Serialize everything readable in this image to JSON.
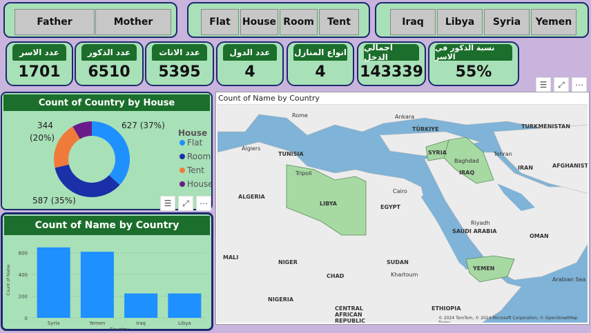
{
  "slicers": {
    "relation": [
      "Father",
      "Mother"
    ],
    "house": [
      "Flat",
      "House",
      "Room",
      "Tent"
    ],
    "country": [
      "Iraq",
      "Libya",
      "Syria",
      "Yemen"
    ]
  },
  "cards": [
    {
      "label": "عدد الاسر",
      "value": "1701"
    },
    {
      "label": "عدد الذكور",
      "value": "6510"
    },
    {
      "label": "عدد الاناث",
      "value": "5395"
    },
    {
      "label": "عدد الدول",
      "value": "4"
    },
    {
      "label": "انواع المنازل",
      "value": "4"
    },
    {
      "label": "اجمالي الدخل",
      "value": "143339"
    },
    {
      "label": "نسبة الذكور في الاسر",
      "value": "55%"
    }
  ],
  "donut": {
    "title": "Count of Country by House",
    "legend_title": "House",
    "labels": {
      "a": "627 (37%)",
      "b": "344",
      "b2": "(20%)",
      "c": "587 (35%)"
    },
    "chart_data": {
      "type": "pie",
      "categories": [
        "Flat",
        "Room",
        "Tent",
        "House"
      ],
      "values": [
        627,
        587,
        344,
        143
      ],
      "colors": [
        "#1e90ff",
        "#1a2fa8",
        "#f07a3a",
        "#6a1b8a"
      ]
    }
  },
  "bar": {
    "title": "Count of Name by Country",
    "xlabel": "Country",
    "ylabel": "Count of Name",
    "chart_data": {
      "type": "bar",
      "categories": [
        "Syria",
        "Yemen",
        "Iraq",
        "Libya"
      ],
      "values": [
        650,
        610,
        225,
        225
      ],
      "ylim": [
        0,
        700
      ],
      "yticks": [
        0,
        200,
        400,
        600
      ],
      "color": "#1e90ff"
    }
  },
  "map": {
    "title": "Count of Name by Country",
    "attribution": "© 2024 TomTom, © 2024 Microsoft Corporation, © OpenStreetMap  Terms"
  },
  "icons": {
    "filter": "filter-icon",
    "focus": "focus-mode-icon",
    "more": "more-options-icon"
  }
}
